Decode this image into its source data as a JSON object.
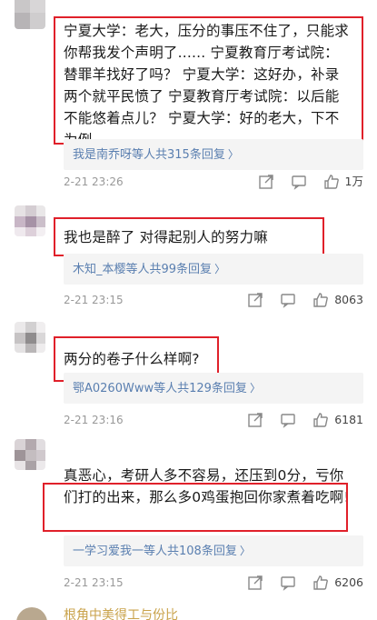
{
  "comments": [
    {
      "text": "宁夏大学：老大，压分的事压不住了，只能求你帮我发个声明了...... 宁夏教育厅考试院：替罪羊找好了吗？ 宁夏大学：这好办，补录两个就平民愤了 宁夏教育厅考试院：以后能不能悠着点儿？ 宁夏大学：好的老大，下不为例",
      "reply_users": "我是南乔呀等人",
      "reply_count": "共315条回复",
      "time": "2-21 23:26",
      "likes": "1万"
    },
    {
      "text": "我也是醉了 对得起别人的努力嘛",
      "reply_users": "木知_本樱等人",
      "reply_count": "共99条回复",
      "time": "2-21 23:15",
      "likes": "8063"
    },
    {
      "text": "两分的卷子什么样啊?",
      "reply_users": "鄂A0260Www等人",
      "reply_count": "共129条回复",
      "time": "2-21 23:16",
      "likes": "6181"
    },
    {
      "text": "真恶心，考研人多不容易，还压到0分，亏你们打的出来，那么多0鸡蛋抱回你家煮着吃啊!",
      "reply_users": "一学习爱我一等人",
      "reply_count": "共108条回复",
      "time": "2-21 23:15",
      "likes": "6206"
    }
  ],
  "partial_comment_text": "根角中美得工与份比"
}
